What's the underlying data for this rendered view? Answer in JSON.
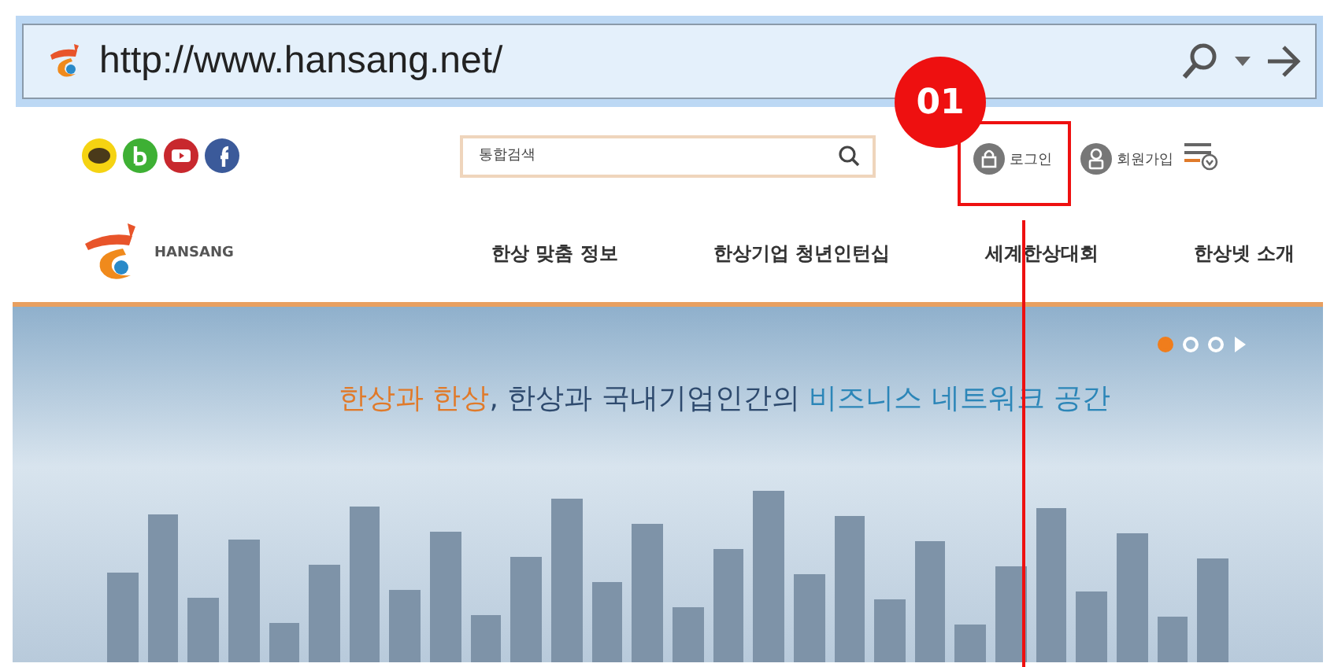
{
  "address_bar": {
    "url": "http://www.hansang.net/"
  },
  "header": {
    "search": {
      "placeholder": "통합검색"
    },
    "user_links": [
      {
        "kind": "login",
        "label": "로그인"
      },
      {
        "kind": "join",
        "label": "회원가입"
      }
    ],
    "logo": {
      "text": "HANSANG"
    },
    "nav": [
      {
        "label": "한상 맞춤 정보"
      },
      {
        "label": "한상기업 청년인턴십"
      },
      {
        "label": "세계한상대회"
      },
      {
        "label": "한상넷 소개"
      }
    ]
  },
  "hero": {
    "headline": [
      {
        "text": "한상과 한상",
        "color": "#e07a2a"
      },
      {
        "text": ", 한상과 국내기업인간의 ",
        "color": "#2e4a6e"
      },
      {
        "text": "비즈니스 네트워크 공간",
        "color": "#2c86b8"
      }
    ],
    "dots": [
      {
        "selected": true
      },
      {
        "selected": false
      },
      {
        "selected": false
      }
    ]
  },
  "callout": {
    "number": "01"
  }
}
